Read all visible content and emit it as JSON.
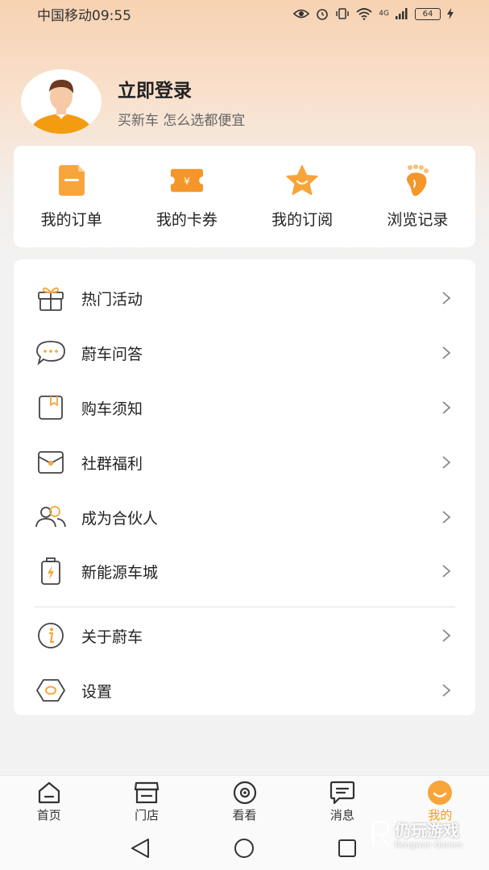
{
  "status_bar": {
    "carrier_time": "中国移动09:55",
    "network": "4G",
    "battery": "64"
  },
  "profile": {
    "title": "立即登录",
    "subtitle": "买新车 怎么选都便宜"
  },
  "quick_actions": [
    {
      "label": "我的订单",
      "icon": "order-icon"
    },
    {
      "label": "我的卡券",
      "icon": "coupon-icon"
    },
    {
      "label": "我的订阅",
      "icon": "star-icon"
    },
    {
      "label": "浏览记录",
      "icon": "footprint-icon"
    }
  ],
  "menu": [
    {
      "label": "热门活动",
      "icon": "gift-icon"
    },
    {
      "label": "蔚车问答",
      "icon": "chat-bubble-icon"
    },
    {
      "label": "购车须知",
      "icon": "bookmark-note-icon"
    },
    {
      "label": "社群福利",
      "icon": "envelope-icon"
    },
    {
      "label": "成为合伙人",
      "icon": "partners-icon"
    },
    {
      "label": "新能源车城",
      "icon": "battery-charge-icon"
    },
    {
      "label": "关于蔚车",
      "icon": "info-icon"
    },
    {
      "label": "设置",
      "icon": "settings-icon"
    }
  ],
  "tabbar": [
    {
      "label": "首页",
      "icon": "home-icon"
    },
    {
      "label": "门店",
      "icon": "store-icon"
    },
    {
      "label": "看看",
      "icon": "eye-icon"
    },
    {
      "label": "消息",
      "icon": "message-icon"
    },
    {
      "label": "我的",
      "icon": "smile-icon",
      "active": true
    }
  ],
  "watermark": {
    "text": "仍玩游戏",
    "sub": "Rengwan Games"
  },
  "colors": {
    "accent": "#f39c12",
    "accent_light": "#f7b24a"
  }
}
